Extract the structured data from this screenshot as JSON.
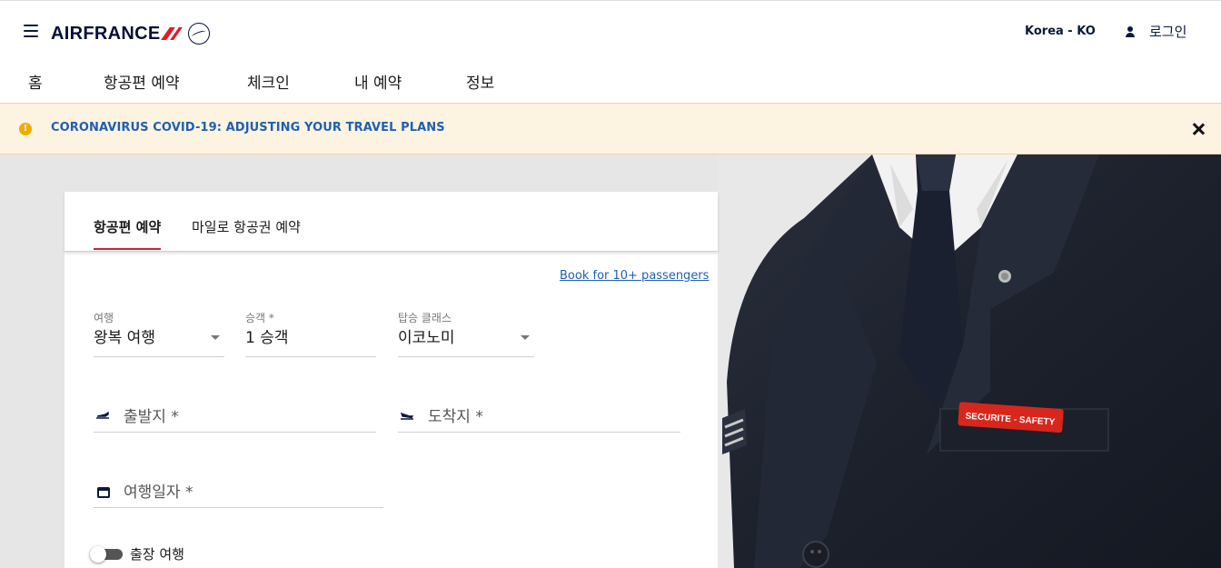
{
  "header": {
    "logo_text": "AIRFRANCE",
    "locale": "Korea - KO",
    "login_label": "로그인"
  },
  "nav": {
    "items": [
      {
        "label": "홈"
      },
      {
        "label": "항공편 예약"
      },
      {
        "label": "체크인"
      },
      {
        "label": "내 예약"
      },
      {
        "label": "정보"
      }
    ]
  },
  "alert": {
    "icon_symbol": "!",
    "text": "CORONAVIRUS COVID-19: ADJUSTING YOUR TRAVEL PLANS"
  },
  "hero": {
    "badge_text": "SECURITE - SAFETY"
  },
  "booking": {
    "tabs": [
      {
        "label": "항공편 예약",
        "active": true
      },
      {
        "label": "마일로 항공권 예약",
        "active": false
      }
    ],
    "group_link": "Book for 10+ passengers",
    "trip": {
      "label": "여행",
      "value": "왕복 여행"
    },
    "passengers": {
      "label": "승객 *",
      "value": "1 승객"
    },
    "cabin": {
      "label": "탑승 클래스",
      "value": "이코노미"
    },
    "origin": {
      "placeholder": "출발지 *"
    },
    "destination": {
      "placeholder": "도착지 *"
    },
    "date": {
      "placeholder": "여행일자 *"
    },
    "business_trip": {
      "label": "출장 여행",
      "enabled": false
    }
  },
  "colors": {
    "brand_navy": "#051039",
    "brand_red": "#e31b23",
    "link_blue": "#1f5fb3",
    "alert_bg": "#fdf3e1",
    "alert_icon": "#f2a900",
    "tab_underline": "#d11f2f"
  }
}
